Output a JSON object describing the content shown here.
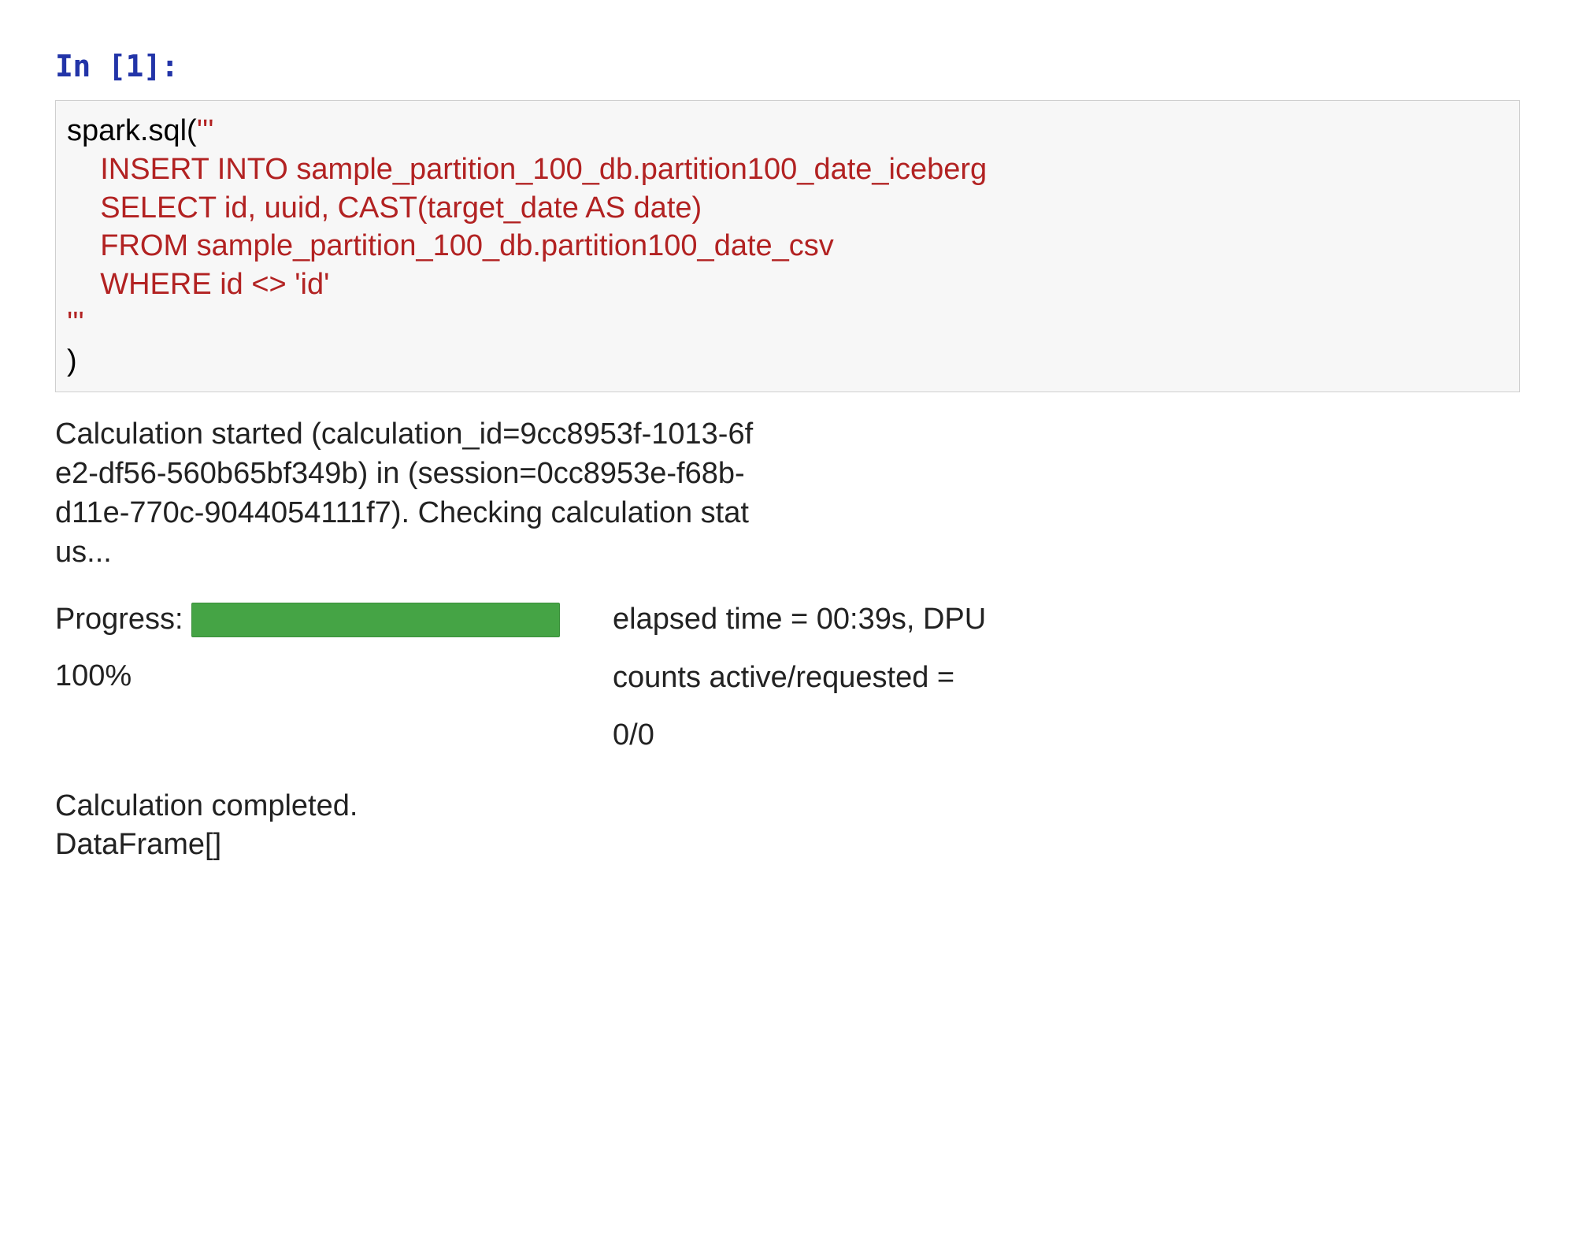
{
  "prompt": {
    "label": "In [1]:"
  },
  "code": {
    "line1_a": "spark.sql(",
    "line1_b": "'''",
    "line2": "    INSERT INTO sample_partition_100_db.partition100_date_iceberg",
    "line3": "    SELECT id, uuid, CAST(target_date AS date)",
    "line4": "    FROM sample_partition_100_db.partition100_date_csv",
    "line5": "    WHERE id <> 'id'",
    "line6": "'''",
    "line7": ")"
  },
  "output": {
    "status_line1": "Calculation started (calculation_id=9cc8953f-1013-6f",
    "status_line2": "e2-df56-560b65bf349b) in (session=0cc8953e-f68b-",
    "status_line3": "d11e-770c-9044054111f7). Checking calculation stat",
    "status_line4": "us...",
    "progress_label": "Progress:",
    "progress_percent": "100%",
    "elapsed_line": "elapsed time = 00:39s, DPU",
    "counts_line": "counts active/requested =",
    "counts_value": "0/0",
    "completed": "Calculation completed.",
    "dataframe": "DataFrame[]"
  },
  "colors": {
    "prompt": "#2234a8",
    "string": "#b22222",
    "progress_bar": "#45a445",
    "cell_bg": "#f7f7f7",
    "cell_border": "#cfcfcf"
  }
}
